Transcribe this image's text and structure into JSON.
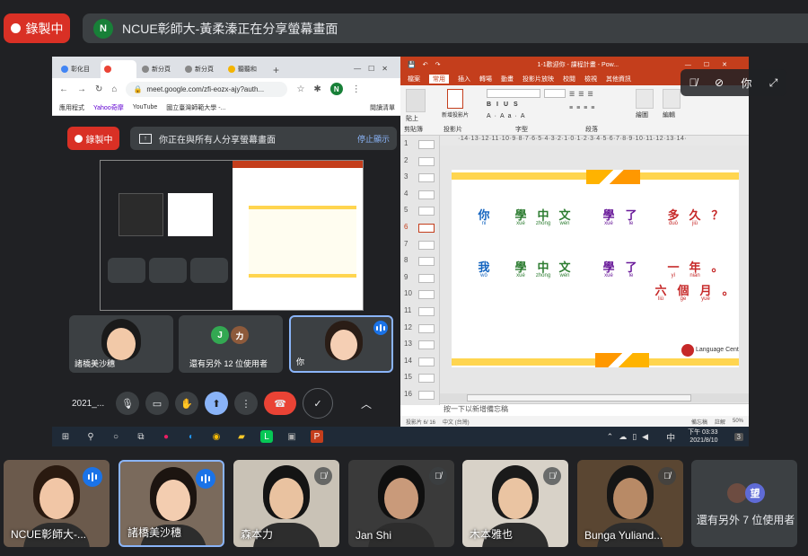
{
  "top": {
    "recording_label": "錄製中",
    "presenter_initial": "N",
    "presenter_color": "#188038",
    "sharing_text": "NCUE彰師大-黃柔溱正在分享螢幕畫面"
  },
  "chrome": {
    "tabs": [
      "彰化目",
      "",
      "新分頁",
      "新分頁",
      "聽聽和"
    ],
    "new_tab": "+",
    "url": "meet.google.com/zfi-eozx-ajy?auth...",
    "profile_initial": "N",
    "bookmarks": [
      "應用程式",
      "Yahoo奇摩",
      "YouTube",
      "國立臺灣師範大學 -..."
    ],
    "reading_list": "閱讀清單"
  },
  "inner_meet": {
    "recording_label": "錄製中",
    "share_text": "你正在與所有人分享螢幕畫面",
    "stop_label": "停止顯示",
    "tiles": [
      {
        "name": "諸橋美沙穗"
      },
      {
        "name": "還有另外 12 位使用者",
        "initials": [
          "J",
          "カ"
        ]
      },
      {
        "name": "你"
      }
    ],
    "meeting_code": "2021_..."
  },
  "ppt": {
    "title": "1-1歡迎你 - 課程計畫 - Pow...",
    "tabs": [
      "檔案",
      "常用",
      "插入",
      "轉場",
      "動畫",
      "投影片放映",
      "校閱",
      "檢視",
      "其他資訊"
    ],
    "ribbon_groups": [
      "剪貼簿",
      "投影片",
      "字型",
      "段落",
      "繪圖",
      "編輯"
    ],
    "ribbon_buttons": [
      "貼上",
      "新增投影片",
      "繪圖",
      "編輯"
    ],
    "ruler": "·14·13·12·11·10·9·8·7·6·5·4·3·2·1·0·1·2·3·4·5·6·7·8·9·10·11·12·13·14·",
    "slide_numbers": [
      "1",
      "2",
      "3",
      "4",
      "5",
      "6",
      "7",
      "8",
      "9",
      "10",
      "11",
      "12",
      "13",
      "14",
      "15",
      "16"
    ],
    "current_slide": "6",
    "line1": [
      {
        "ch": "你",
        "py": "nǐ",
        "color": "#1565c0"
      },
      {
        "ch": "學",
        "py": "xué",
        "color": "#2e7d32"
      },
      {
        "ch": "中",
        "py": "zhōng",
        "color": "#2e7d32"
      },
      {
        "ch": "文",
        "py": "wén",
        "color": "#2e7d32"
      },
      {
        "ch": "學",
        "py": "xué",
        "color": "#6a1b9a"
      },
      {
        "ch": "了",
        "py": "le",
        "color": "#6a1b9a"
      },
      {
        "ch": "多",
        "py": "duō",
        "color": "#c62828"
      },
      {
        "ch": "久",
        "py": "jiǔ",
        "color": "#c62828"
      },
      {
        "ch": "？",
        "py": "",
        "color": "#c62828"
      }
    ],
    "line2": [
      {
        "ch": "我",
        "py": "wǒ",
        "color": "#1565c0"
      },
      {
        "ch": "學",
        "py": "xué",
        "color": "#2e7d32"
      },
      {
        "ch": "中",
        "py": "zhōng",
        "color": "#2e7d32"
      },
      {
        "ch": "文",
        "py": "wén",
        "color": "#2e7d32"
      },
      {
        "ch": "學",
        "py": "xué",
        "color": "#6a1b9a"
      },
      {
        "ch": "了",
        "py": "le",
        "color": "#6a1b9a"
      },
      {
        "ch": "一",
        "py": "yì",
        "color": "#c62828"
      },
      {
        "ch": "年",
        "py": "nián",
        "color": "#c62828"
      },
      {
        "ch": "。",
        "py": "",
        "color": "#c62828"
      }
    ],
    "line3": [
      {
        "ch": "六",
        "py": "liù",
        "color": "#c62828"
      },
      {
        "ch": "個",
        "py": "ge",
        "color": "#c62828"
      },
      {
        "ch": "月",
        "py": "yuè",
        "color": "#c62828"
      },
      {
        "ch": "。",
        "py": "",
        "color": "#c62828"
      }
    ],
    "logo_text": "Language Cent",
    "notes_placeholder": "按一下以新增備忘稿",
    "status": [
      "投影片 6/ 16",
      "中文 (台灣)",
      "備忘稿",
      "註解",
      "50%"
    ]
  },
  "taskbar": {
    "input_mode": "中",
    "time": "下午 03:33",
    "date": "2021/8/10",
    "notifications": "3"
  },
  "overlay": {
    "you_label": "你"
  },
  "participants": [
    {
      "name": "NCUE彰師大-...",
      "speaking": true
    },
    {
      "name": "諸橋美沙穗",
      "speaking": true,
      "highlight": true
    },
    {
      "name": "森本力",
      "speaking": false
    },
    {
      "name": "Jan Shi",
      "speaking": false
    },
    {
      "name": "木本雅也",
      "speaking": false
    },
    {
      "name": "Bunga Yuliand...",
      "speaking": false
    }
  ],
  "more": {
    "label": "還有另外 7 位使用者",
    "initial": "望",
    "color": "#5f6bd6"
  }
}
